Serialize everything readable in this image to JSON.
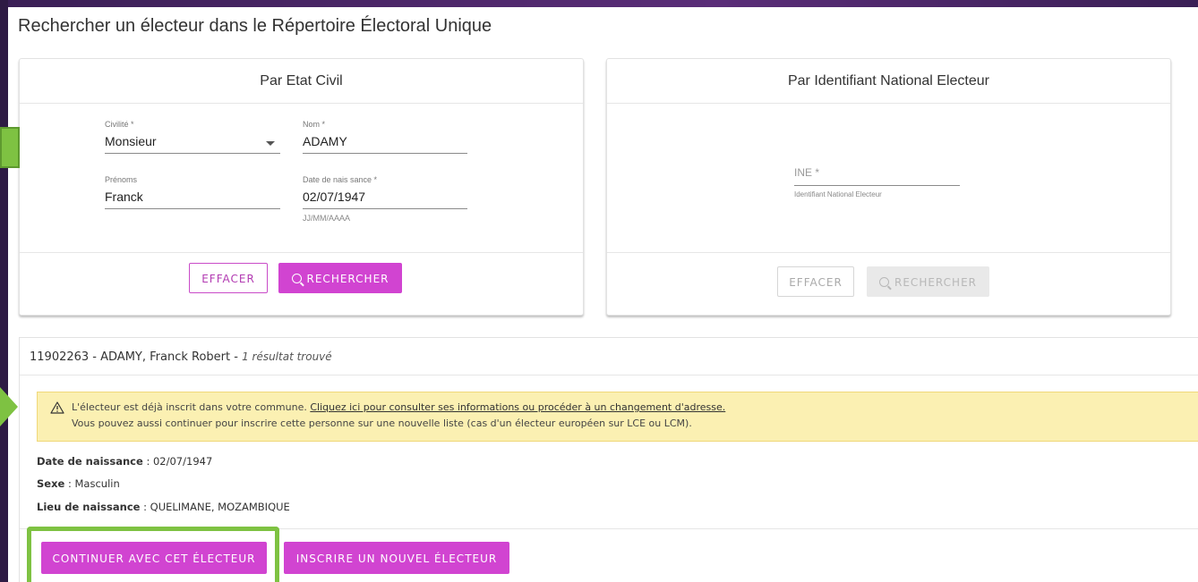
{
  "page_title": "Rechercher un électeur dans le Répertoire Électoral Unique",
  "etat_civil_card": {
    "header": "Par Etat Civil",
    "civilite_label": "Civilité *",
    "civilite_value": "Monsieur",
    "nom_label": "Nom *",
    "nom_value": "ADAMY",
    "prenoms_label": "Prénoms",
    "prenoms_value": "Franck",
    "date_label": "Date de nais sance *",
    "date_value": "02/07/1947",
    "date_hint": "JJ/MM/AAAA",
    "clear_button": "EFFACER",
    "search_button": "RECHERCHER"
  },
  "ine_card": {
    "header": "Par Identifiant National Electeur",
    "ine_placeholder": "INE *",
    "ine_hint": "Identifiant National Electeur",
    "clear_button": "EFFACER",
    "search_button": "RECHERCHER"
  },
  "result": {
    "heading": "11902263 - ADAMY, Franck Robert - ",
    "count": "1 résultat trouvé",
    "alert_text1": "L'électeur est déjà inscrit dans votre commune. ",
    "alert_link": "Cliquez ici pour consulter ses informations ou procéder à un changement d'adresse.",
    "alert_text2": "Vous pouvez aussi continuer pour inscrire cette personne sur une nouvelle liste (cas d'un électeur européen sur LCE ou LCM).",
    "birth_label": "Date de naissance",
    "birth_value": " : 02/07/1947",
    "sex_label": "Sexe",
    "sex_value": " : Masculin",
    "place_label": "Lieu de naissance",
    "place_value": " : QUELIMANE, MOZAMBIQUE",
    "continue_button": "CONTINUER AVEC CET ÉLECTEUR",
    "new_button": "INSCRIRE UN NOUVEL ÉLECTEUR"
  },
  "colors": {
    "primary": "#d144d1",
    "alert_bg": "#fbf0b2",
    "highlight": "#7ec242"
  }
}
